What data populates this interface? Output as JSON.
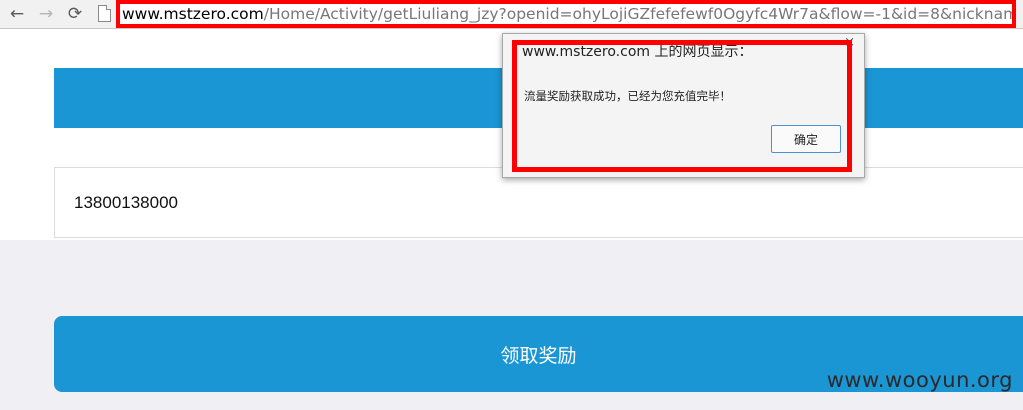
{
  "browser": {
    "back_icon": "←",
    "forward_icon": "→",
    "reload_icon": "⟳",
    "url_host": "www.mstzero.com",
    "url_path": "/Home/Activity/getLiuliang_jzy?openid=ohyLojiGZfefefewf0Ogyfc4Wr7a&flow=-1&id=8&nickname=ceqwjffef"
  },
  "form": {
    "phone_value": "13800138000",
    "claim_button_label": "领取奖励"
  },
  "alert": {
    "title": "www.mstzero.com 上的网页显示：",
    "message": "流量奖励获取成功，已经为您充值完毕！",
    "ok_label": "确定",
    "close_icon": "×"
  },
  "watermark": "www.wooyun.org",
  "colors": {
    "primary_blue": "#1a96d4",
    "highlight_red": "#ff0000"
  }
}
